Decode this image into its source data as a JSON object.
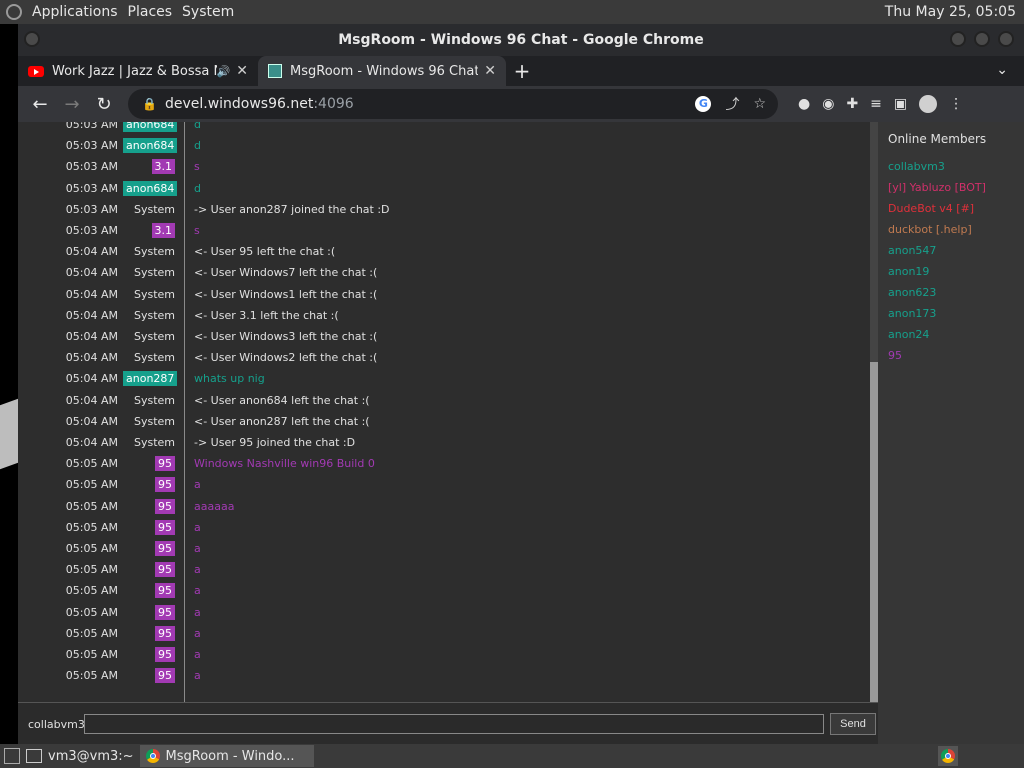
{
  "desktop": {
    "menus": [
      "Applications",
      "Places",
      "System"
    ],
    "clock": "Thu May 25, 05:05"
  },
  "window": {
    "title": "MsgRoom - Windows 96 Chat - Google Chrome"
  },
  "tabs": [
    {
      "label": "Work Jazz | Jazz & Bossa N",
      "icon": "youtube-icon",
      "active": false
    },
    {
      "label": "MsgRoom - Windows 96 Chat",
      "icon": "windows96-icon",
      "active": true
    }
  ],
  "address": {
    "host": "devel.windows96.net",
    "port": ":4096"
  },
  "colors": {
    "teal": "#16a08c",
    "purple": "#a23ab3",
    "system": "#e0e0e0",
    "red": "#e0303a",
    "orange": "#c07a50",
    "pink": "#d0306a"
  },
  "messages": [
    {
      "time": "05:03 AM",
      "user": "anon684",
      "color": "#16a08c",
      "badge": true,
      "text": "d",
      "text_color": "#16a08c"
    },
    {
      "time": "05:03 AM",
      "user": "anon684",
      "color": "#16a08c",
      "badge": true,
      "text": "d",
      "text_color": "#16a08c"
    },
    {
      "time": "05:03 AM",
      "user": "3.1",
      "color": "#a23ab3",
      "badge": true,
      "text": "s",
      "text_color": "#a23ab3"
    },
    {
      "time": "05:03 AM",
      "user": "anon684",
      "color": "#16a08c",
      "badge": true,
      "text": "d",
      "text_color": "#16a08c"
    },
    {
      "time": "05:03 AM",
      "user": "System",
      "color": "#e0e0e0",
      "badge": false,
      "text": "-> User anon287 joined the chat :D",
      "text_color": "#e0e0e0"
    },
    {
      "time": "05:03 AM",
      "user": "3.1",
      "color": "#a23ab3",
      "badge": true,
      "text": "s",
      "text_color": "#a23ab3"
    },
    {
      "time": "05:04 AM",
      "user": "System",
      "color": "#e0e0e0",
      "badge": false,
      "text": "<- User 95 left the chat :(",
      "text_color": "#e0e0e0"
    },
    {
      "time": "05:04 AM",
      "user": "System",
      "color": "#e0e0e0",
      "badge": false,
      "text": "<- User Windows7 left the chat :(",
      "text_color": "#e0e0e0"
    },
    {
      "time": "05:04 AM",
      "user": "System",
      "color": "#e0e0e0",
      "badge": false,
      "text": "<- User Windows1 left the chat :(",
      "text_color": "#e0e0e0"
    },
    {
      "time": "05:04 AM",
      "user": "System",
      "color": "#e0e0e0",
      "badge": false,
      "text": "<- User 3.1 left the chat :(",
      "text_color": "#e0e0e0"
    },
    {
      "time": "05:04 AM",
      "user": "System",
      "color": "#e0e0e0",
      "badge": false,
      "text": "<- User Windows3 left the chat :(",
      "text_color": "#e0e0e0"
    },
    {
      "time": "05:04 AM",
      "user": "System",
      "color": "#e0e0e0",
      "badge": false,
      "text": "<- User Windows2 left the chat :(",
      "text_color": "#e0e0e0"
    },
    {
      "time": "05:04 AM",
      "user": "anon287",
      "color": "#16a08c",
      "badge": true,
      "text": "whats up nig",
      "text_color": "#16a08c"
    },
    {
      "time": "05:04 AM",
      "user": "System",
      "color": "#e0e0e0",
      "badge": false,
      "text": "<- User anon684 left the chat :(",
      "text_color": "#e0e0e0"
    },
    {
      "time": "05:04 AM",
      "user": "System",
      "color": "#e0e0e0",
      "badge": false,
      "text": "<- User anon287 left the chat :(",
      "text_color": "#e0e0e0"
    },
    {
      "time": "05:04 AM",
      "user": "System",
      "color": "#e0e0e0",
      "badge": false,
      "text": "-> User 95 joined the chat :D",
      "text_color": "#e0e0e0"
    },
    {
      "time": "05:05 AM",
      "user": "95",
      "color": "#a23ab3",
      "badge": true,
      "text": "Windows Nashville win96 Build 0",
      "text_color": "#a23ab3"
    },
    {
      "time": "05:05 AM",
      "user": "95",
      "color": "#a23ab3",
      "badge": true,
      "text": "a",
      "text_color": "#a23ab3"
    },
    {
      "time": "05:05 AM",
      "user": "95",
      "color": "#a23ab3",
      "badge": true,
      "text": "aaaaaa",
      "text_color": "#a23ab3"
    },
    {
      "time": "05:05 AM",
      "user": "95",
      "color": "#a23ab3",
      "badge": true,
      "text": "a",
      "text_color": "#a23ab3"
    },
    {
      "time": "05:05 AM",
      "user": "95",
      "color": "#a23ab3",
      "badge": true,
      "text": "a",
      "text_color": "#a23ab3"
    },
    {
      "time": "05:05 AM",
      "user": "95",
      "color": "#a23ab3",
      "badge": true,
      "text": "a",
      "text_color": "#a23ab3"
    },
    {
      "time": "05:05 AM",
      "user": "95",
      "color": "#a23ab3",
      "badge": true,
      "text": "a",
      "text_color": "#a23ab3"
    },
    {
      "time": "05:05 AM",
      "user": "95",
      "color": "#a23ab3",
      "badge": true,
      "text": "a",
      "text_color": "#a23ab3"
    },
    {
      "time": "05:05 AM",
      "user": "95",
      "color": "#a23ab3",
      "badge": true,
      "text": "a",
      "text_color": "#a23ab3"
    },
    {
      "time": "05:05 AM",
      "user": "95",
      "color": "#a23ab3",
      "badge": true,
      "text": "a",
      "text_color": "#a23ab3"
    },
    {
      "time": "05:05 AM",
      "user": "95",
      "color": "#a23ab3",
      "badge": true,
      "text": "a",
      "text_color": "#a23ab3"
    }
  ],
  "members": {
    "heading": "Online Members",
    "list": [
      {
        "name": "collabvm3",
        "color": "#16a08c"
      },
      {
        "name": "[yl] Yabluzo [BOT]",
        "color": "#d0306a"
      },
      {
        "name": "DudeBot v4 [#]",
        "color": "#e0303a"
      },
      {
        "name": "duckbot [.help]",
        "color": "#c07a50"
      },
      {
        "name": "anon547",
        "color": "#16a08c"
      },
      {
        "name": "anon19",
        "color": "#16a08c"
      },
      {
        "name": "anon623",
        "color": "#16a08c"
      },
      {
        "name": "anon173",
        "color": "#16a08c"
      },
      {
        "name": "anon24",
        "color": "#16a08c"
      },
      {
        "name": "95",
        "color": "#a23ab3"
      }
    ]
  },
  "composer": {
    "username": "collabvm3",
    "value": "",
    "send_label": "Send"
  },
  "taskbar": {
    "items": [
      "vm3@vm3:~",
      "MsgRoom - Windo..."
    ]
  }
}
